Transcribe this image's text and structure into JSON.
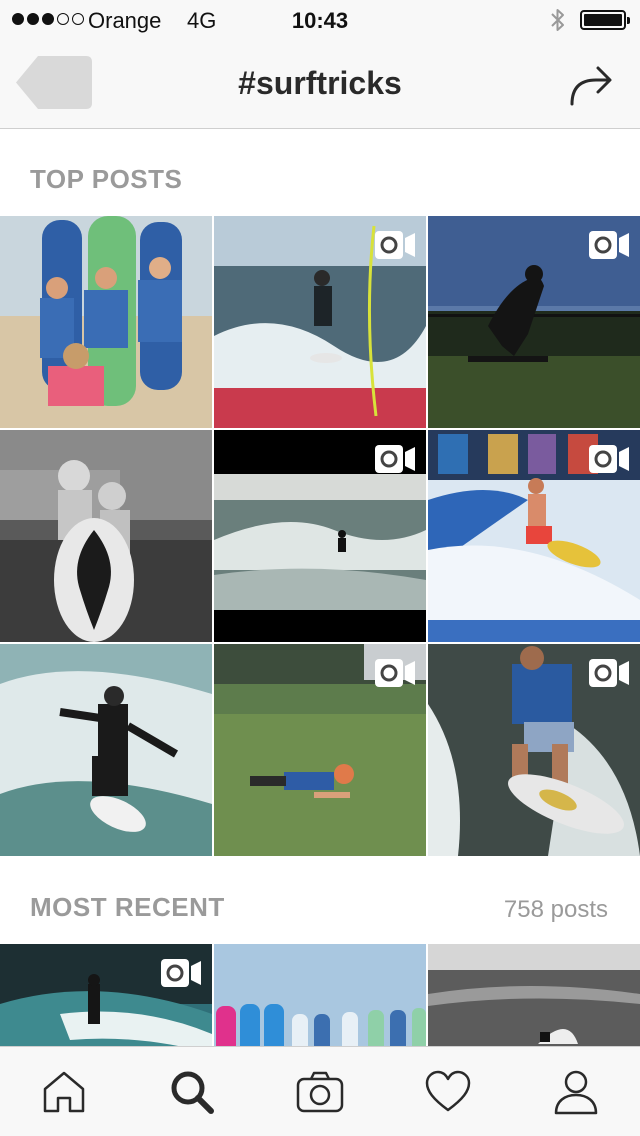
{
  "status_bar": {
    "signal_bars": 3,
    "signal_total": 5,
    "carrier": "Orange",
    "network": "4G",
    "time": "10:43",
    "bluetooth_icon": "bluetooth-icon",
    "battery_icon": "battery-icon",
    "battery_level": 0.9
  },
  "nav": {
    "back_icon": "back-arrow-icon",
    "title": "#surftricks",
    "share_icon": "share-arrow-icon"
  },
  "top_posts": {
    "header": "TOP POSTS",
    "posts": [
      {
        "subject": "boys-with-surfboards-on-beach",
        "is_video": false
      },
      {
        "subject": "wakesurfer-behind-boat",
        "is_video": true
      },
      {
        "subject": "skateboarder-silhouette",
        "is_video": true
      },
      {
        "subject": "kids-with-bodyboard-bw",
        "is_video": false
      },
      {
        "subject": "surfer-on-wave",
        "is_video": true
      },
      {
        "subject": "flowrider-surfer",
        "is_video": true
      },
      {
        "subject": "surfer-carving-spray",
        "is_video": false
      },
      {
        "subject": "kid-lying-on-grass",
        "is_video": true
      },
      {
        "subject": "wakesurfer-life-vest",
        "is_video": true
      }
    ]
  },
  "most_recent": {
    "header": "MOST RECENT",
    "count": "758 posts",
    "posts": [
      {
        "subject": "surfer-riding-wave-cliffs",
        "is_video": true
      },
      {
        "subject": "surfboards-lined-up",
        "is_video": false
      },
      {
        "subject": "surfer-bw-wave",
        "is_video": false
      }
    ]
  },
  "tab_bar": {
    "tabs": [
      "home-icon",
      "search-icon",
      "camera-icon",
      "heart-icon",
      "profile-icon"
    ],
    "active": "search-icon"
  },
  "colors": {
    "bar_background": "#f8f8f8",
    "section_header": "#9a9a9a",
    "icon": "#2a2a2a"
  }
}
